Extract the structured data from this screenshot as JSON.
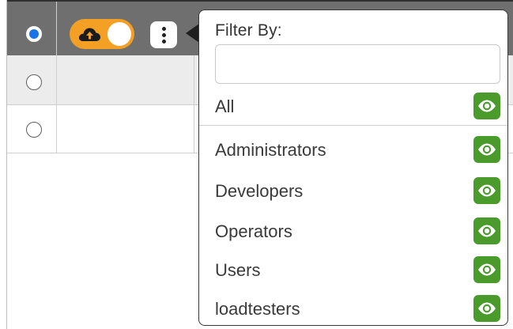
{
  "popover": {
    "filter_label": "Filter By:",
    "filter_input_value": "",
    "filter_input_placeholder": "",
    "all_label": "All",
    "groups": [
      {
        "label": "Administrators"
      },
      {
        "label": "Developers"
      },
      {
        "label": "Operators"
      },
      {
        "label": "Users"
      },
      {
        "label": "loadtesters"
      }
    ]
  },
  "colors": {
    "header_bg": "#6f6f6f",
    "toggle_bg": "#f4a024",
    "eye_button_bg": "#4a9a2c",
    "radio_selected": "#1a73e8",
    "selected_row_bg": "#ececec"
  },
  "icons": {
    "toggle_icon": "cloud-upload-icon",
    "menu_icon": "kebab-menu-icon",
    "visibility_icon": "eye-icon"
  }
}
